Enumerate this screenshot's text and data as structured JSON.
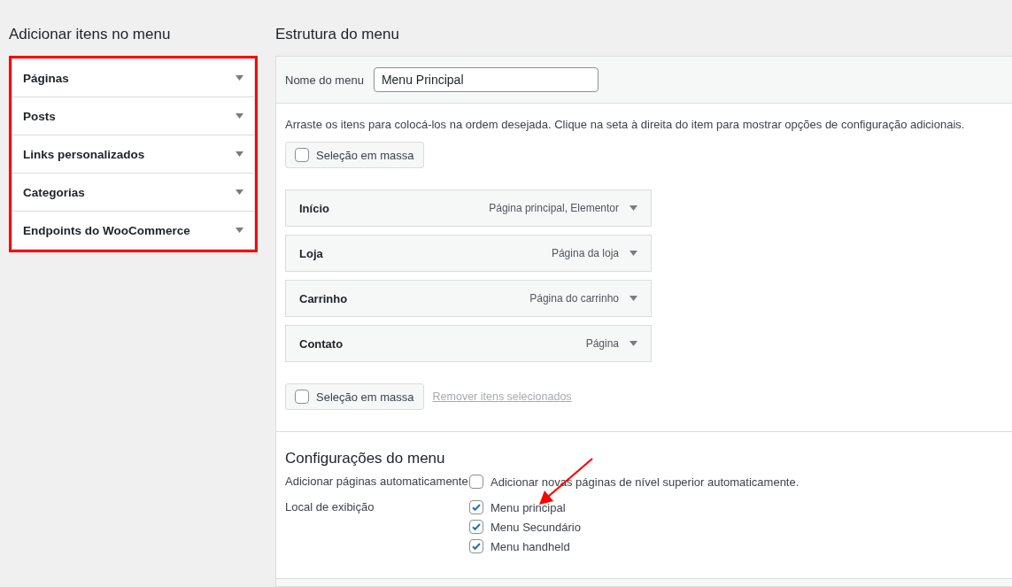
{
  "add_items": {
    "title": "Adicionar itens no menu",
    "highlighted": true,
    "sections": [
      {
        "label": "Páginas"
      },
      {
        "label": "Posts"
      },
      {
        "label": "Links personalizados"
      },
      {
        "label": "Categorias"
      },
      {
        "label": "Endpoints do WooCommerce"
      }
    ]
  },
  "structure": {
    "title": "Estrutura do menu",
    "name_label": "Nome do menu",
    "name_value": "Menu Principal",
    "instructions": "Arraste os itens para colocá-los na ordem desejada. Clique na seta à direita do item para mostrar opções de configuração adicionais.",
    "bulk_top": {
      "label": "Seleção em massa",
      "checked": false
    },
    "items": [
      {
        "title": "Início",
        "type": "Página principal, Elementor"
      },
      {
        "title": "Loja",
        "type": "Página da loja"
      },
      {
        "title": "Carrinho",
        "type": "Página do carrinho"
      },
      {
        "title": "Contato",
        "type": "Página"
      }
    ],
    "bulk_bottom": {
      "label": "Seleção em massa",
      "checked": false
    },
    "remove_link": "Remover itens selecionados"
  },
  "settings": {
    "title": "Configurações do menu",
    "auto_add_label": "Adicionar páginas automaticamente",
    "auto_add": {
      "label": "Adicionar novas páginas de nível superior automaticamente.",
      "checked": false
    },
    "locations_label": "Local de exibição",
    "locations": [
      {
        "label": "Menu principal",
        "checked": true
      },
      {
        "label": "Menu Secundário",
        "checked": true
      },
      {
        "label": "Menu handheld",
        "checked": true
      }
    ],
    "arrow_annotation": true
  }
}
